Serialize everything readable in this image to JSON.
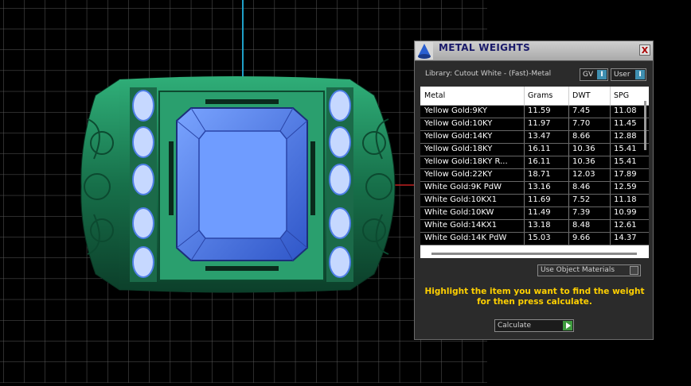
{
  "panel": {
    "title": "METAL WEIGHTS",
    "close_label": "X",
    "library_label": "Library: Cutout White - (Fast)-Metal",
    "gv_toggle": {
      "label": "GV",
      "knob": "I"
    },
    "user_toggle": {
      "label": "User",
      "knob": "I"
    },
    "table": {
      "headers": {
        "metal": "Metal",
        "grams": "Grams",
        "dwt": "DWT",
        "spg": "SPG"
      },
      "rows": [
        {
          "metal": "Yellow Gold:9KY",
          "grams": "11.59",
          "dwt": "7.45",
          "spg": "11.08"
        },
        {
          "metal": "Yellow Gold:10KY",
          "grams": "11.97",
          "dwt": "7.70",
          "spg": "11.45"
        },
        {
          "metal": "Yellow Gold:14KY",
          "grams": "13.47",
          "dwt": "8.66",
          "spg": "12.88"
        },
        {
          "metal": "Yellow Gold:18KY",
          "grams": "16.11",
          "dwt": "10.36",
          "spg": "15.41"
        },
        {
          "metal": "Yellow Gold:18KY R...",
          "grams": "16.11",
          "dwt": "10.36",
          "spg": "15.41"
        },
        {
          "metal": "Yellow Gold:22KY",
          "grams": "18.71",
          "dwt": "12.03",
          "spg": "17.89"
        },
        {
          "metal": "White Gold:9K PdW",
          "grams": "13.16",
          "dwt": "8.46",
          "spg": "12.59"
        },
        {
          "metal": "White Gold:10KX1",
          "grams": "11.69",
          "dwt": "7.52",
          "spg": "11.18"
        },
        {
          "metal": "White Gold:10KW",
          "grams": "11.49",
          "dwt": "7.39",
          "spg": "10.99"
        },
        {
          "metal": "White Gold:14KX1",
          "grams": "13.18",
          "dwt": "8.48",
          "spg": "12.61"
        },
        {
          "metal": "White Gold:14K PdW",
          "grams": "15.03",
          "dwt": "9.66",
          "spg": "14.37"
        }
      ]
    },
    "use_object_materials_label": "Use Object Materials",
    "instruction": "Highlight the item you want to find the weight for then press calculate.",
    "calculate_label": "Calculate"
  },
  "colors": {
    "viewport_background": "#000000",
    "grid_line": "#5a5a5a",
    "metal_green": "#1f8a5c",
    "stone_blue": "#4f7fe6",
    "instruction_text": "#ffd000",
    "axis_cyan": "#1fa0c8"
  },
  "icons": {
    "panel_logo": "blue-cone-logo-icon",
    "close": "close-icon",
    "calculate": "play-icon"
  }
}
